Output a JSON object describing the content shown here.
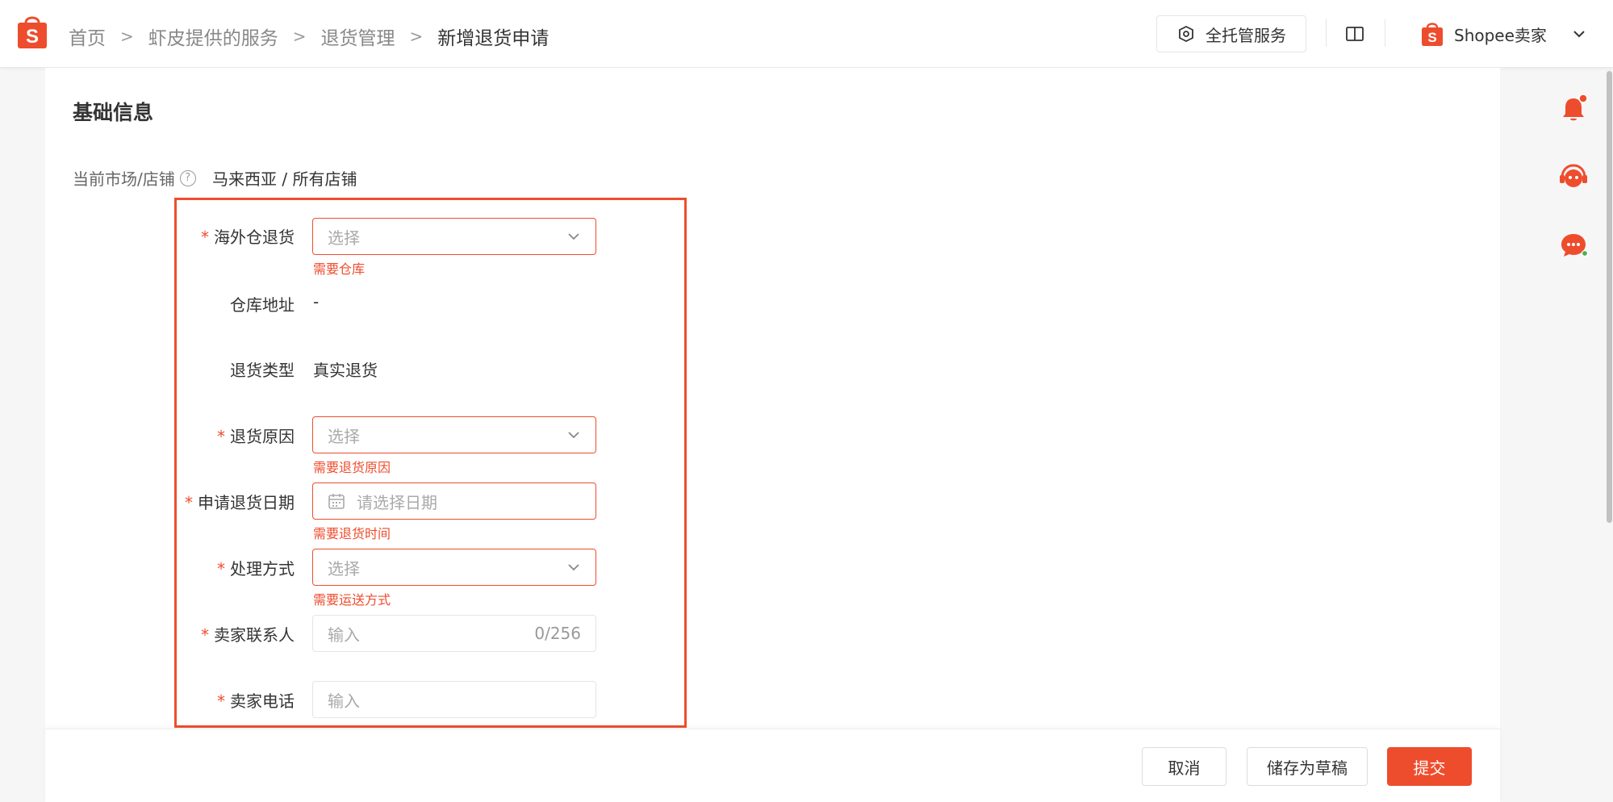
{
  "breadcrumb": {
    "items": [
      "首页",
      "虾皮提供的服务",
      "退货管理"
    ],
    "current": "新增退货申请",
    "separator": ">"
  },
  "header": {
    "hosted_service_label": "全托管服务",
    "seller_label": "Shopee卖家"
  },
  "form": {
    "section_title": "基础信息",
    "market": {
      "label": "当前市场/店铺",
      "value": "马来西亚 / 所有店铺"
    },
    "required_mark": "*",
    "warehouse_return": {
      "label": "海外仓退货",
      "placeholder": "选择",
      "error": "需要仓库"
    },
    "warehouse_address": {
      "label": "仓库地址",
      "value": "-"
    },
    "return_type": {
      "label": "退货类型",
      "value": "真实退货"
    },
    "return_reason": {
      "label": "退货原因",
      "placeholder": "选择",
      "error": "需要退货原因"
    },
    "return_date": {
      "label": "申请退货日期",
      "placeholder": "请选择日期",
      "error": "需要退货时间"
    },
    "handling_method": {
      "label": "处理方式",
      "placeholder": "选择",
      "error": "需要运送方式"
    },
    "seller_contact": {
      "label": "卖家联系人",
      "placeholder": "输入",
      "counter": "0/256"
    },
    "seller_phone": {
      "label": "卖家电话",
      "placeholder": "输入"
    }
  },
  "footer": {
    "cancel_label": "取消",
    "save_draft_label": "储存为草稿",
    "submit_label": "提交"
  },
  "colors": {
    "accent": "#ee4d2d"
  },
  "icons": [
    "shopee-logo-icon",
    "hosted-service-icon",
    "book-icon",
    "chevron-down-icon",
    "bell-icon",
    "support-icon",
    "chat-icon",
    "calendar-icon",
    "help-icon"
  ]
}
